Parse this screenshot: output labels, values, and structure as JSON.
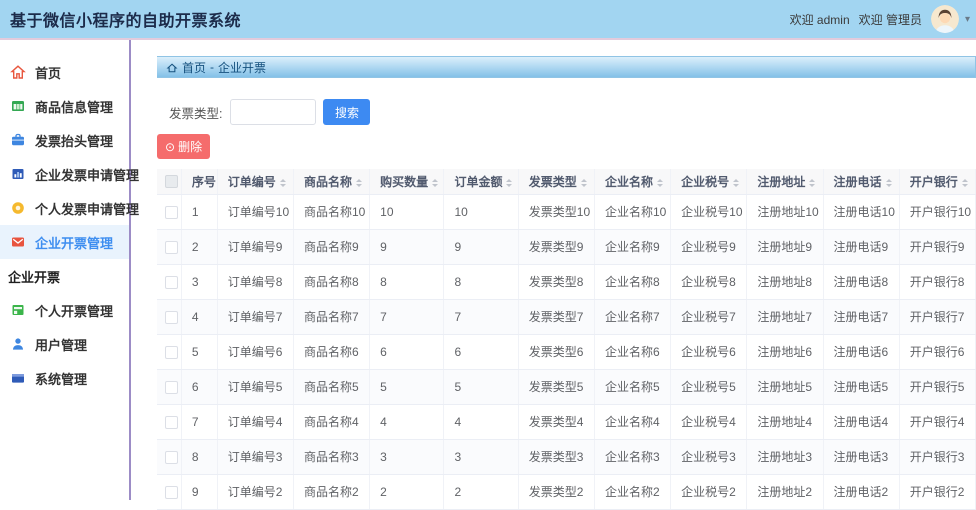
{
  "app": {
    "title": "基于微信小程序的自助开票系统"
  },
  "topbar": {
    "welcome_user": "欢迎 admin",
    "welcome_role": "欢迎 管理员"
  },
  "sidebar": {
    "items": [
      {
        "label": "首页",
        "icon": "home-icon"
      },
      {
        "label": "商品信息管理",
        "icon": "product-table-icon"
      },
      {
        "label": "发票抬头管理",
        "icon": "briefcase-icon"
      },
      {
        "label": "企业发票申请管理",
        "icon": "bar-chart-icon"
      },
      {
        "label": "个人发票申请管理",
        "icon": "coin-icon"
      },
      {
        "label": "企业开票管理",
        "icon": "envelope-icon",
        "active": true
      },
      {
        "label": "企业开票",
        "section": true
      },
      {
        "label": "个人开票管理",
        "icon": "storefront-icon"
      },
      {
        "label": "用户管理",
        "icon": "user-icon"
      },
      {
        "label": "系统管理",
        "icon": "system-window-icon"
      }
    ]
  },
  "breadcrumb": {
    "home": "首页",
    "separator": "-",
    "current": "企业开票"
  },
  "toolbar": {
    "filter_label": "发票类型:",
    "filter_value": "",
    "search_button": "搜索",
    "delete_button": "删除"
  },
  "table": {
    "columns": [
      {
        "label": "序号",
        "sortable": false
      },
      {
        "label": "订单编号",
        "sortable": true
      },
      {
        "label": "商品名称",
        "sortable": true
      },
      {
        "label": "购买数量",
        "sortable": true
      },
      {
        "label": "订单金额",
        "sortable": true
      },
      {
        "label": "发票类型",
        "sortable": true
      },
      {
        "label": "企业名称",
        "sortable": true
      },
      {
        "label": "企业税号",
        "sortable": true
      },
      {
        "label": "注册地址",
        "sortable": true
      },
      {
        "label": "注册电话",
        "sortable": true
      },
      {
        "label": "开户银行",
        "sortable": true
      }
    ],
    "rows": [
      [
        "1",
        "订单编号10",
        "商品名称10",
        "10",
        "10",
        "发票类型10",
        "企业名称10",
        "企业税号10",
        "注册地址10",
        "注册电话10",
        "开户银行10"
      ],
      [
        "2",
        "订单编号9",
        "商品名称9",
        "9",
        "9",
        "发票类型9",
        "企业名称9",
        "企业税号9",
        "注册地址9",
        "注册电话9",
        "开户银行9"
      ],
      [
        "3",
        "订单编号8",
        "商品名称8",
        "8",
        "8",
        "发票类型8",
        "企业名称8",
        "企业税号8",
        "注册地址8",
        "注册电话8",
        "开户银行8"
      ],
      [
        "4",
        "订单编号7",
        "商品名称7",
        "7",
        "7",
        "发票类型7",
        "企业名称7",
        "企业税号7",
        "注册地址7",
        "注册电话7",
        "开户银行7"
      ],
      [
        "5",
        "订单编号6",
        "商品名称6",
        "6",
        "6",
        "发票类型6",
        "企业名称6",
        "企业税号6",
        "注册地址6",
        "注册电话6",
        "开户银行6"
      ],
      [
        "6",
        "订单编号5",
        "商品名称5",
        "5",
        "5",
        "发票类型5",
        "企业名称5",
        "企业税号5",
        "注册地址5",
        "注册电话5",
        "开户银行5"
      ],
      [
        "7",
        "订单编号4",
        "商品名称4",
        "4",
        "4",
        "发票类型4",
        "企业名称4",
        "企业税号4",
        "注册地址4",
        "注册电话4",
        "开户银行4"
      ],
      [
        "8",
        "订单编号3",
        "商品名称3",
        "3",
        "3",
        "发票类型3",
        "企业名称3",
        "企业税号3",
        "注册地址3",
        "注册电话3",
        "开户银行3"
      ],
      [
        "9",
        "订单编号2",
        "商品名称2",
        "2",
        "2",
        "发票类型2",
        "企业名称2",
        "企业税号2",
        "注册地址2",
        "注册电话2",
        "开户银行2"
      ]
    ]
  },
  "colors": {
    "topbar_bg": "#a2d5f1",
    "sidebar_divider": "#9c8cc6",
    "active_item_text": "#3e8ef0",
    "active_item_bg": "#e9f3fd",
    "accent_blue": "#3d8af2",
    "danger_red": "#f56c6c",
    "breadcrumb_text": "#16527f"
  }
}
